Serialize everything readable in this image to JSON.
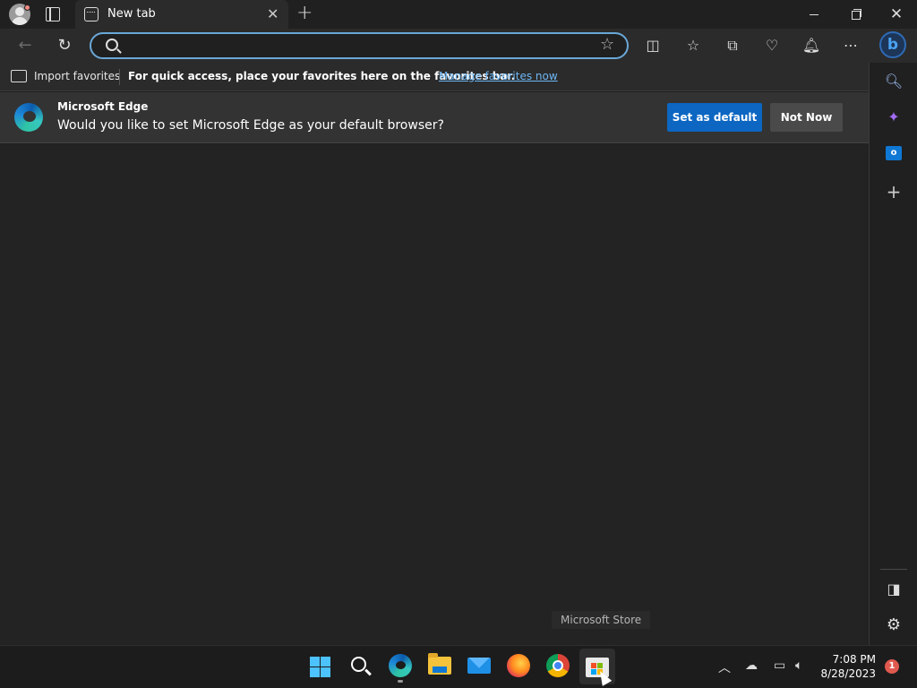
{
  "tab": {
    "title": "New tab"
  },
  "address": {
    "value": "",
    "placeholder": ""
  },
  "favorites_bar": {
    "import_label": "Import favorites",
    "hint": "For quick access, place your favorites here on the favorites bar.",
    "manage_link": "Manage favorites now"
  },
  "infobar": {
    "title": "Microsoft Edge",
    "message": "Would you like to set Microsoft Edge as your default browser?",
    "set_default_label": "Set as default",
    "not_now_label": "Not Now"
  },
  "tooltip": {
    "text": "Microsoft Store"
  },
  "taskbar": {
    "time": "7:08 PM",
    "date": "8/28/2023",
    "notification_count": "1",
    "apps": [
      "start",
      "search",
      "edge",
      "file-explorer",
      "mail",
      "firefox",
      "chrome",
      "microsoft-store"
    ]
  },
  "colors": {
    "accent": "#0c66c2",
    "link": "#6db6f5",
    "address_focus": "#6aa8d8",
    "background": "#202020"
  }
}
